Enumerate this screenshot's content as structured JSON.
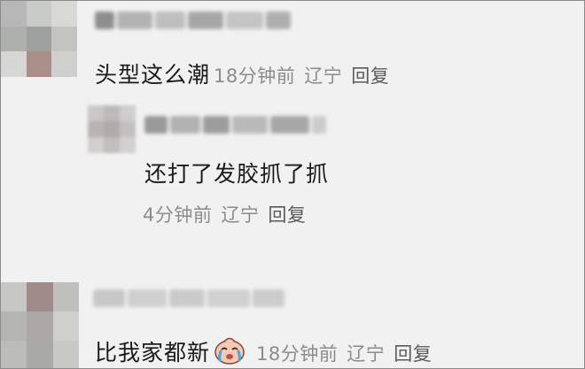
{
  "comments": [
    {
      "text": "头型这么潮",
      "time": "18分钟前",
      "location": "辽宁",
      "reply_label": "回复"
    },
    {
      "text": "还打了发胶抓了抓",
      "time": "4分钟前",
      "location": "辽宁",
      "reply_label": "回复"
    },
    {
      "text": "比我家都新",
      "time": "18分钟前",
      "location": "辽宁",
      "reply_label": "回复",
      "emoji_icon": "crying-face-emoji-icon"
    }
  ]
}
